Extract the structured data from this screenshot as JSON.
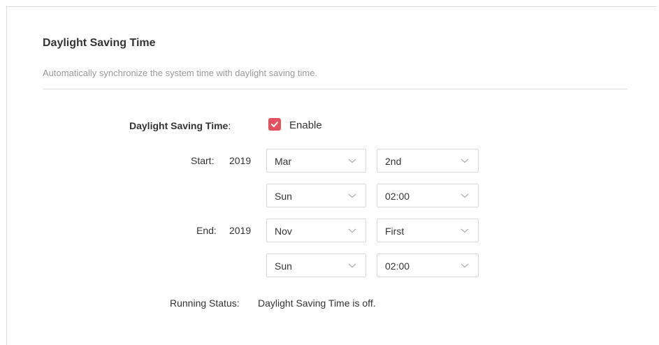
{
  "section": {
    "title": "Daylight Saving Time",
    "description": "Automatically synchronize the system time with daylight saving time."
  },
  "dst": {
    "label": "Daylight Saving Time",
    "colon": ":",
    "enable_label": "Enable",
    "enabled": true,
    "checkbox_color": "#e3515f"
  },
  "start": {
    "label": "Start:",
    "year": "2019",
    "month": "Mar",
    "week": "2nd",
    "day": "Sun",
    "time": "02:00"
  },
  "end": {
    "label": "End:",
    "year": "2019",
    "month": "Nov",
    "week": "First",
    "day": "Sun",
    "time": "02:00"
  },
  "status": {
    "label": "Running Status:",
    "value": "Daylight Saving Time is off."
  },
  "icons": {
    "select": "chevron-down-icon",
    "checkbox": "check-icon"
  }
}
